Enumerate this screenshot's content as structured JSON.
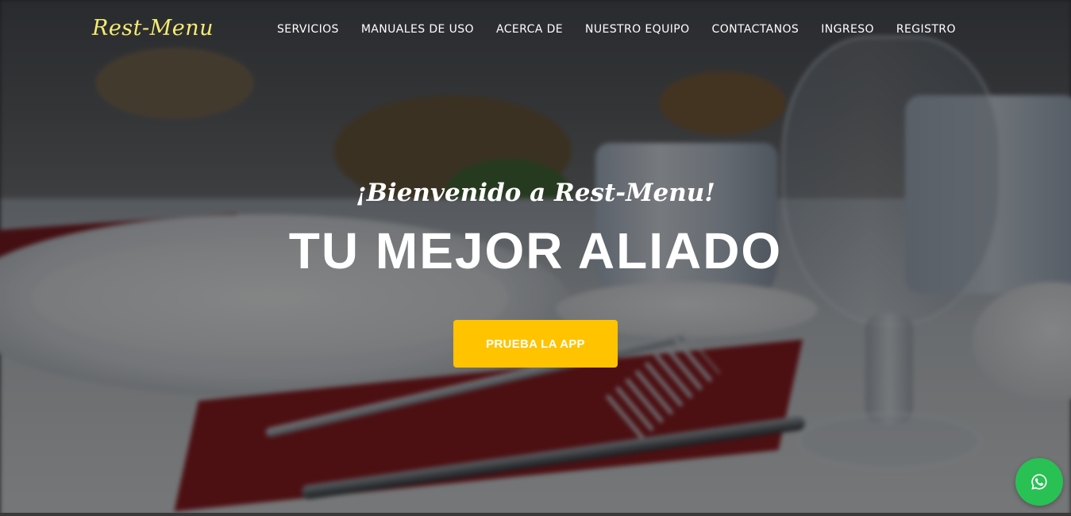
{
  "brand": {
    "logo_text": "Rest-Menu"
  },
  "nav": {
    "items": [
      {
        "label": "SERVICIOS"
      },
      {
        "label": "MANUALES DE USO"
      },
      {
        "label": "ACERCA DE"
      },
      {
        "label": "NUESTRO EQUIPO"
      },
      {
        "label": "CONTACTANOS"
      },
      {
        "label": "INGRESO"
      },
      {
        "label": "REGISTRO"
      }
    ]
  },
  "hero": {
    "welcome": "¡Bienvenido a Rest-Menu!",
    "headline": "TU MEJOR ALIADO",
    "cta_label": "PRUEBA LA APP"
  },
  "floating": {
    "whatsapp_icon": "whatsapp-icon"
  },
  "colors": {
    "logo": "#f6eb70",
    "cta_background": "#ffc300",
    "whatsapp_background": "#29c154",
    "text": "#ffffff"
  }
}
